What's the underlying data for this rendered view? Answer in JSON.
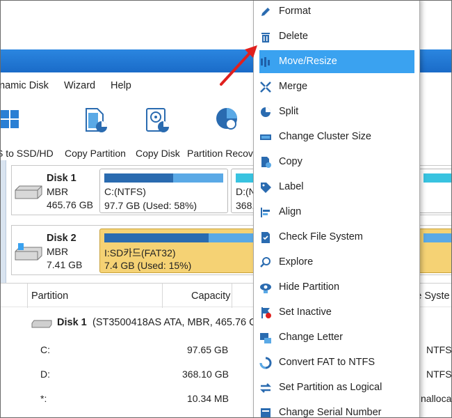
{
  "menubar": {
    "items": [
      "namic Disk",
      "Wizard",
      "Help"
    ]
  },
  "toolbar": {
    "items": [
      {
        "label": "S to SSD/HD",
        "icon": "windows-migrate-icon"
      },
      {
        "label": "Copy Partition",
        "icon": "copy-partition-icon"
      },
      {
        "label": "Copy Disk",
        "icon": "copy-disk-icon"
      },
      {
        "label": "Partition Recov",
        "icon": "partition-recovery-icon"
      }
    ]
  },
  "disks": [
    {
      "name": "Disk 1",
      "type": "MBR",
      "size": "465.76 GB",
      "partitions": [
        {
          "label": "C:(NTFS)",
          "size": "97.7 GB (Used: 58%)",
          "used": 0.58
        },
        {
          "label": "D:(N",
          "size": "368.",
          "used": 0.05
        }
      ]
    },
    {
      "name": "Disk 2",
      "type": "MBR",
      "size": "7.41 GB",
      "partitions": [
        {
          "label": "I:SD카드(FAT32)",
          "size": "7.4 GB (Used: 15%)",
          "used": 0.15
        }
      ]
    }
  ],
  "table": {
    "headers": [
      "Partition",
      "Capacity",
      "le Syste"
    ],
    "disk_line": "Disk 1",
    "disk_detail": "(ST3500418AS ATA, MBR, 465.76 G",
    "rows": [
      {
        "partition": "C:",
        "capacity": "97.65 GB",
        "fs": "NTFS"
      },
      {
        "partition": "D:",
        "capacity": "368.10 GB",
        "fs": "NTFS"
      },
      {
        "partition": "*:",
        "capacity": "10.34 MB",
        "fs": "nallocat"
      }
    ]
  },
  "context_menu": {
    "items": [
      {
        "label": "Format",
        "icon": "pencil-icon"
      },
      {
        "label": "Delete",
        "icon": "trash-icon"
      },
      {
        "label": "Move/Resize",
        "icon": "move-resize-icon",
        "highlighted": true
      },
      {
        "label": "Merge",
        "icon": "merge-icon"
      },
      {
        "label": "Split",
        "icon": "split-icon"
      },
      {
        "label": "Change Cluster Size",
        "icon": "cluster-size-icon"
      },
      {
        "label": "Copy",
        "icon": "copy-icon"
      },
      {
        "label": "Label",
        "icon": "label-icon"
      },
      {
        "label": "Align",
        "icon": "align-icon"
      },
      {
        "label": "Check File System",
        "icon": "check-file-system-icon"
      },
      {
        "label": "Explore",
        "icon": "explore-icon"
      },
      {
        "label": "Hide Partition",
        "icon": "hide-partition-icon"
      },
      {
        "label": "Set Inactive",
        "icon": "set-inactive-icon"
      },
      {
        "label": "Change Letter",
        "icon": "change-letter-icon"
      },
      {
        "label": "Convert FAT to NTFS",
        "icon": "convert-icon"
      },
      {
        "label": "Set Partition as Logical",
        "icon": "set-logical-icon"
      },
      {
        "label": "Change Serial Number",
        "icon": "serial-number-icon"
      }
    ]
  },
  "colors": {
    "accent": "#1a6fcb",
    "highlight": "#3aa2f0",
    "selected_partition": "#f5d274",
    "arrow": "#e0201e"
  }
}
